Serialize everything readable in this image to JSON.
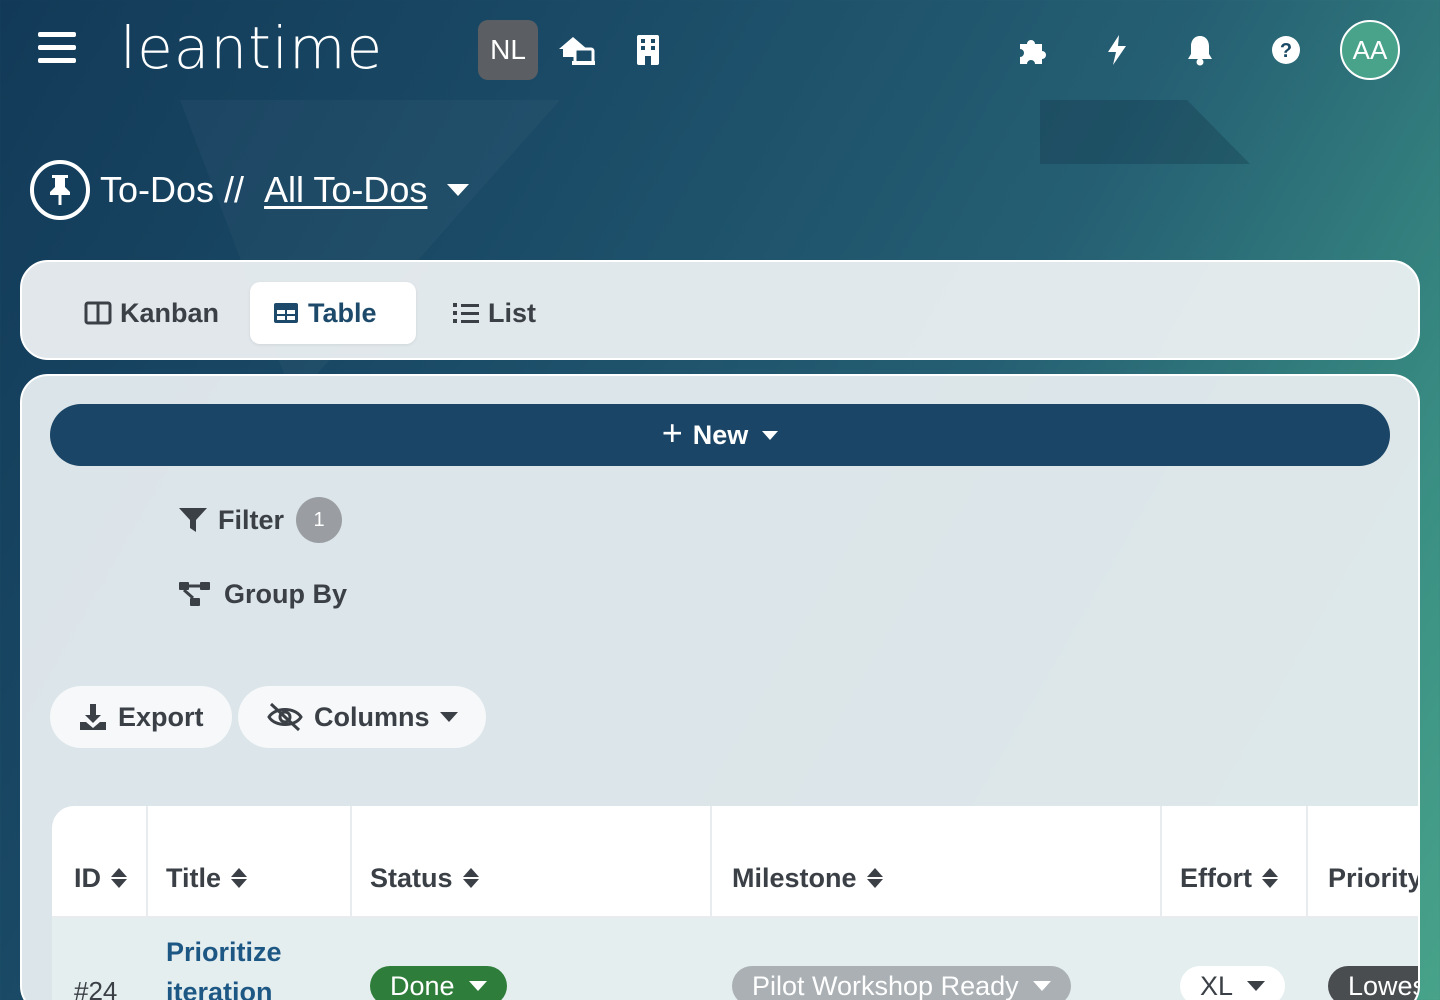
{
  "header": {
    "logo": "leantime",
    "project_badge": "NL",
    "avatar_initials": "AA"
  },
  "page": {
    "title_prefix": "To-Dos //",
    "title_link": "All To-Dos"
  },
  "view_tabs": [
    {
      "label": "Kanban",
      "icon": "kanban-icon",
      "active": false
    },
    {
      "label": "Table",
      "icon": "table-icon",
      "active": true
    },
    {
      "label": "List",
      "icon": "list-icon",
      "active": false
    }
  ],
  "toolbar": {
    "new_label": "New",
    "filter_label": "Filter",
    "filter_count": "1",
    "group_by_label": "Group By",
    "export_label": "Export",
    "columns_label": "Columns"
  },
  "table": {
    "columns": [
      "ID",
      "Title",
      "Status",
      "Milestone",
      "Effort",
      "Priority"
    ],
    "rows": [
      {
        "id": "#24",
        "title": "Prioritize iteration",
        "status": "Done",
        "milestone": "Pilot Workshop Ready",
        "effort": "XL",
        "priority": "Lowest"
      }
    ]
  },
  "colors": {
    "primary": "#1a4566",
    "status_done": "#2e7d3a",
    "milestone_chip": "#aab0b4",
    "priority_chip": "#4a4d50",
    "link": "#1d5784"
  }
}
